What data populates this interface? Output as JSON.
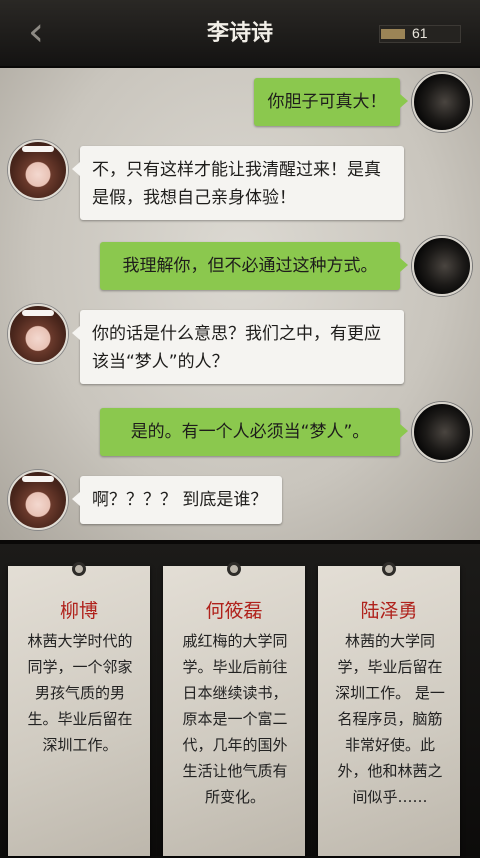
{
  "header": {
    "back_glyph": "‹",
    "title": "李诗诗",
    "battery_text": "61",
    "battery_color": "#9b8456"
  },
  "messages": [
    {
      "side": "out",
      "text": "你胆子可真大！"
    },
    {
      "side": "in",
      "text": "不，只有这样才能让我清醒过来！是真是假，我想自己亲身体验！"
    },
    {
      "side": "out",
      "text": "我理解你，但不必通过这种方式。"
    },
    {
      "side": "in",
      "text": "你的话是什么意思？我们之中，有更应该当“梦人”的人？"
    },
    {
      "side": "out",
      "text": "是的。有一个人必须当“梦人”。"
    },
    {
      "side": "in",
      "text": "啊？？？？ 到底是谁？"
    }
  ],
  "cards": [
    {
      "name": "柳博",
      "desc": "林茜大学时代的同学，一个邻家男孩气质的男生。毕业后留在深圳工作。"
    },
    {
      "name": "何筱磊",
      "desc": "戚红梅的大学同学。毕业后前往日本继续读书，原本是一个富二代，几年的国外生活让他气质有所变化。"
    },
    {
      "name": "陆泽勇",
      "desc": "林茜的大学同学，毕业后留在深圳工作。 是一名程序员，脑筋非常好使。此外，他和林茜之间似乎……"
    }
  ],
  "colors": {
    "outgoing_bubble": "#8bc84e",
    "incoming_bubble": "#f5f4f1",
    "card_name": "#b0221c"
  }
}
